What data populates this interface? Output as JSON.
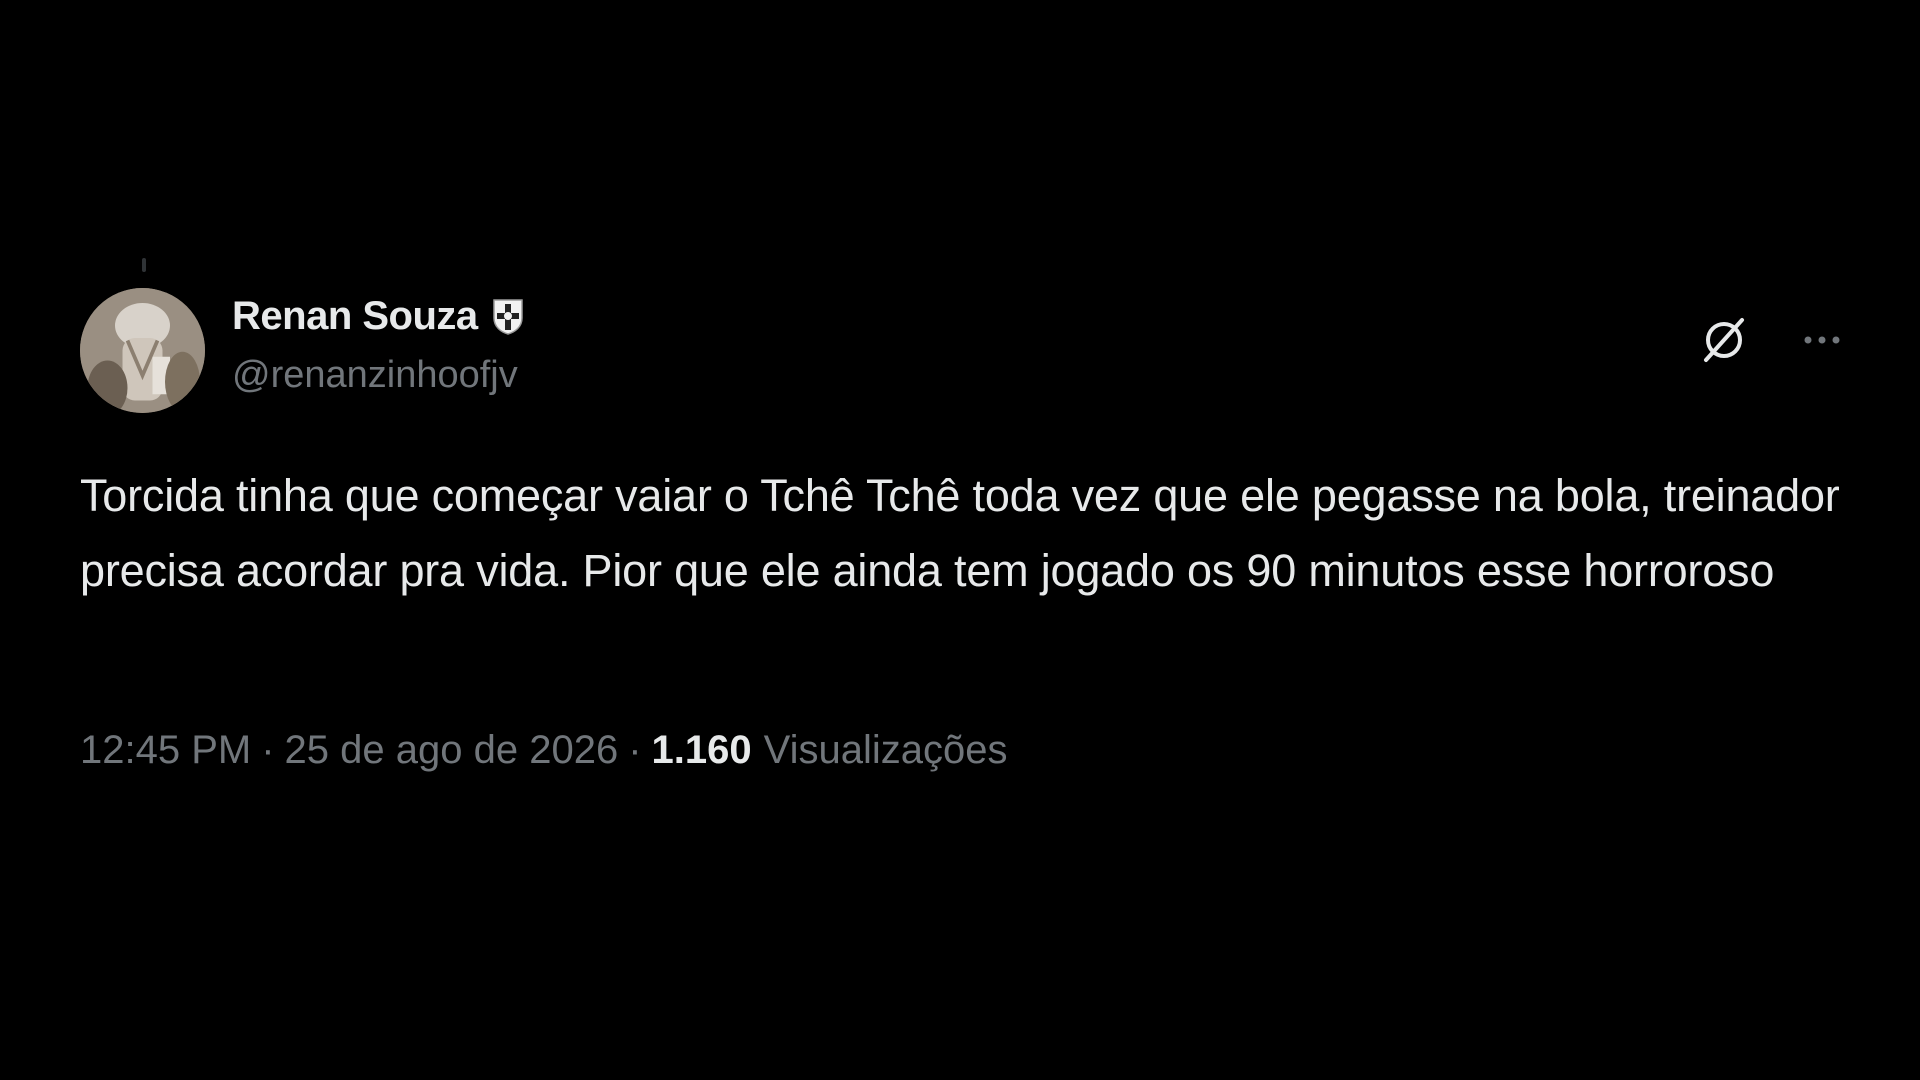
{
  "colors": {
    "background": "#000000",
    "text_primary": "#e7e9ea",
    "text_secondary": "#71767b"
  },
  "tweet": {
    "author": {
      "display_name": "Renan Souza",
      "handle": "@renanzinhoofjv",
      "badge_icon": "team-crest-icon",
      "avatar": "avatar"
    },
    "actions": {
      "grok_icon": "grok-icon",
      "more_icon": "more-icon"
    },
    "text": "Torcida tinha que começar vaiar o Tchê Tchê toda vez que ele pegasse na bola, treinador precisa acordar pra vida. Pior que ele ainda tem jogado os 90 minutos esse horroroso",
    "meta": {
      "time": "12:45 PM",
      "separator": "·",
      "date": "25 de ago de 2026",
      "views_count": "1.160",
      "views_label": "Visualizações"
    }
  }
}
